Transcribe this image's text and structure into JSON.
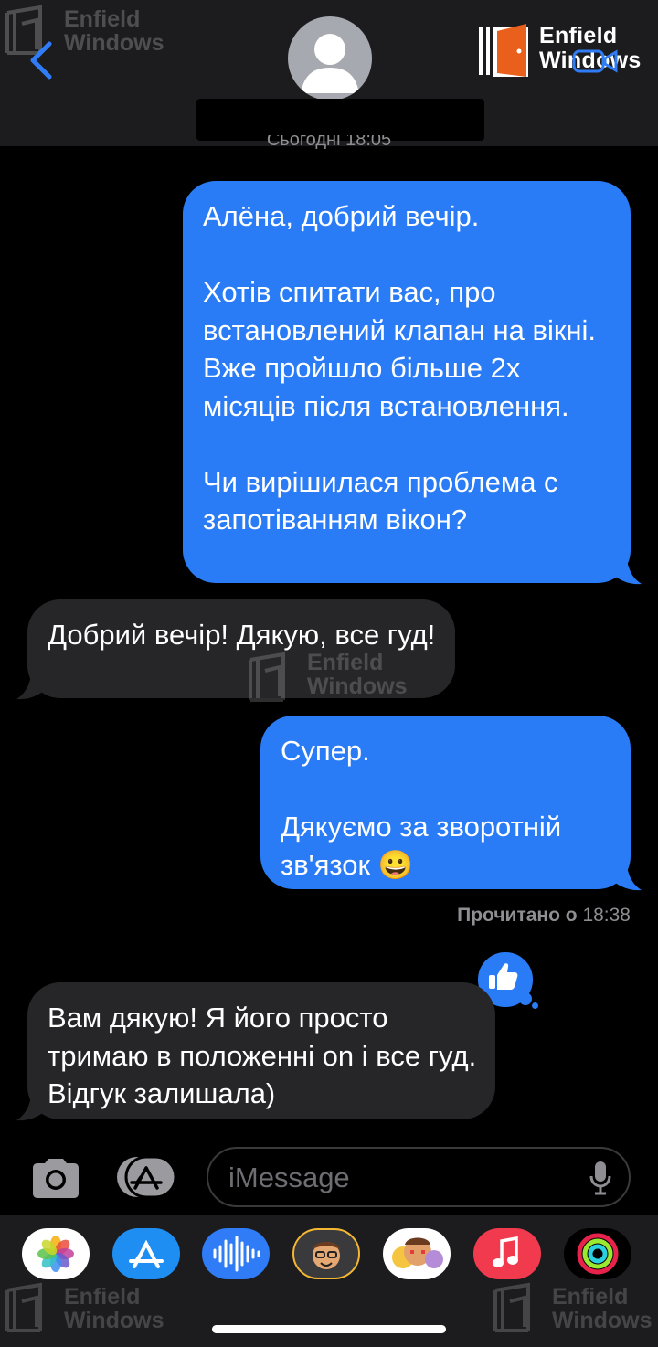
{
  "header": {
    "date_stamp": "Сьогодні 18:05",
    "brand_line1": "Enfield",
    "brand_line2": "Windows"
  },
  "messages": [
    {
      "direction": "outgoing",
      "text": "Алёна, добрий вечір.\n\nХотів спитати вас, про встановлений клапан на вікні. Вже пройшло більше 2х місяців після встановлення.\n\nЧи вирішилася проблема с запотіванням вікон?"
    },
    {
      "direction": "incoming",
      "text": "Добрий вечір! Дякую, все гуд!"
    },
    {
      "direction": "outgoing",
      "text": "Супер.\n\nДякуємо за зворотній зв'язок 😀"
    },
    {
      "direction": "incoming",
      "text": "Вам дякую! Я його просто тримаю в положенні on і все гуд. Відгук залишала)"
    }
  ],
  "read_receipt": {
    "label": "Прочитано о",
    "time": "18:38"
  },
  "tapback": {
    "icon": "thumbs-up-icon"
  },
  "input": {
    "placeholder": "iMessage"
  },
  "app_drawer": [
    "photos-icon",
    "app-store-icon",
    "audio-message-icon",
    "memoji-icon",
    "memoji-stickers-icon",
    "music-icon",
    "activity-icon"
  ],
  "colors": {
    "outgoing": "#2a7cf6",
    "incoming": "#262628",
    "background": "#000000"
  }
}
